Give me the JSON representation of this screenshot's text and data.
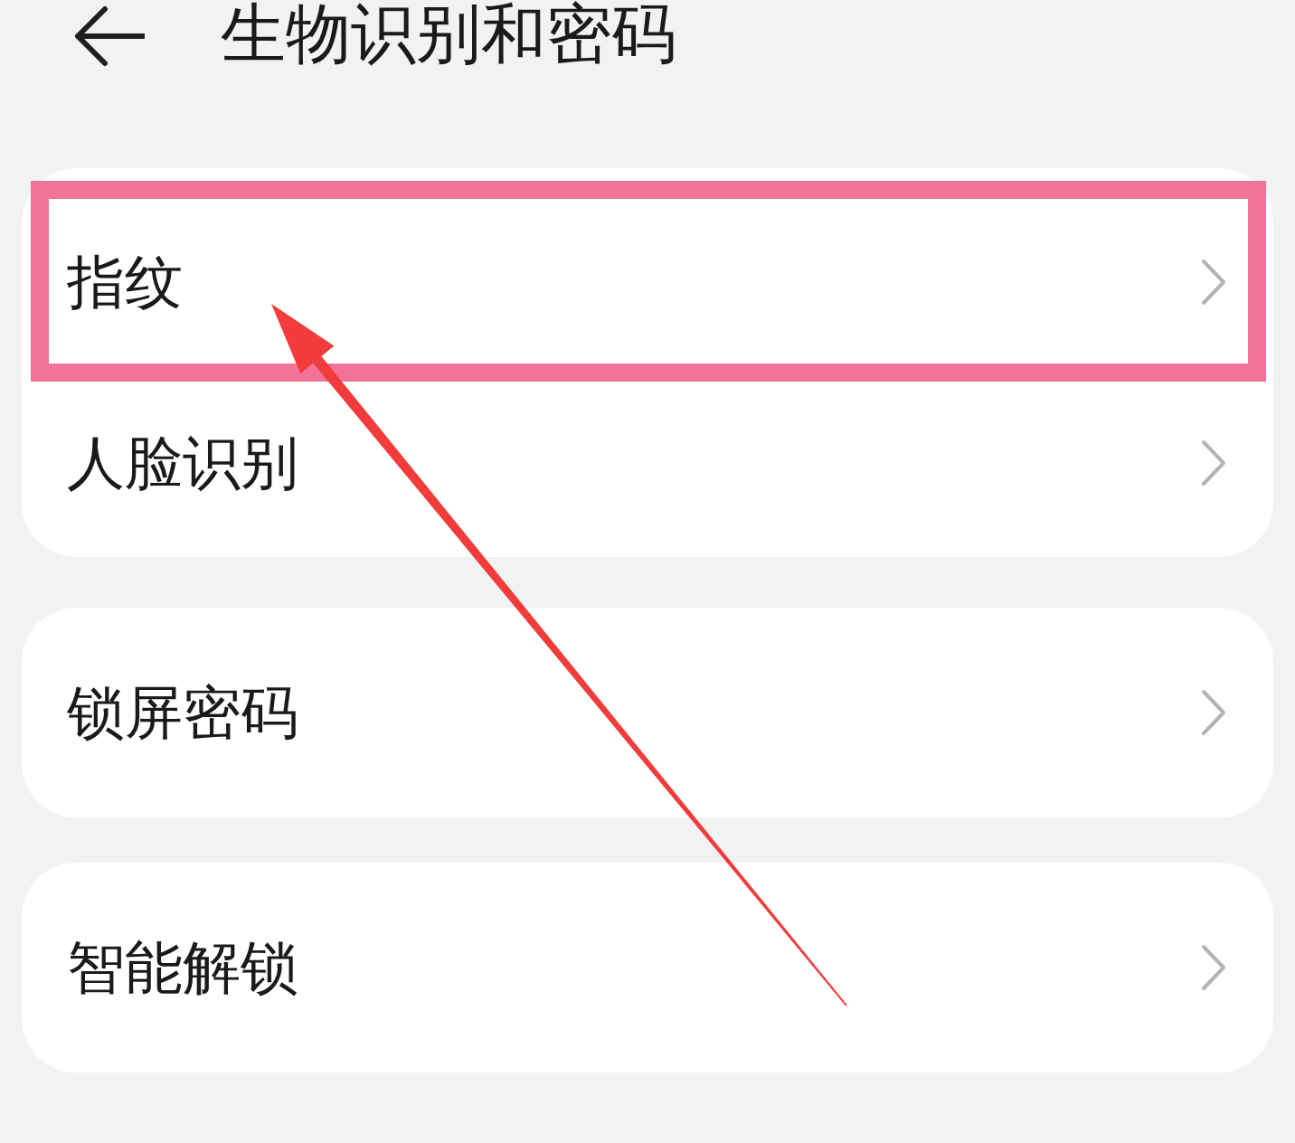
{
  "header": {
    "title": "生物识别和密码"
  },
  "groups": [
    {
      "items": [
        {
          "label": "指纹",
          "highlighted": true
        },
        {
          "label": "人脸识别",
          "highlighted": false
        }
      ]
    },
    {
      "items": [
        {
          "label": "锁屏密码",
          "highlighted": false
        }
      ]
    },
    {
      "items": [
        {
          "label": "智能解锁",
          "highlighted": false
        }
      ]
    }
  ]
}
